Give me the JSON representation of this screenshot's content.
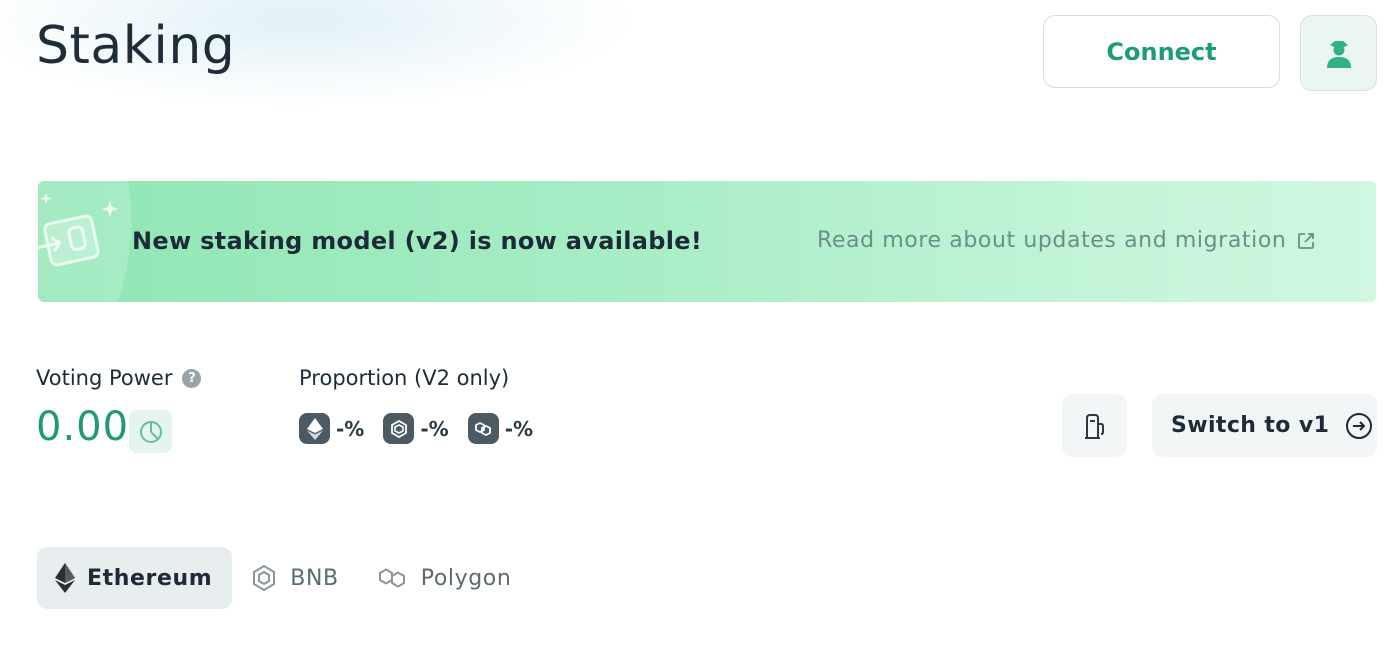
{
  "page": {
    "title": "Staking"
  },
  "header": {
    "connect_label": "Connect"
  },
  "banner": {
    "title": "New staking model (v2) is now available!",
    "link_label": "Read more about updates and migration"
  },
  "voting_power": {
    "label": "Voting Power",
    "value": "0.00",
    "help_glyph": "?"
  },
  "proportion": {
    "label": "Proportion (V2 only)",
    "items": [
      {
        "chain": "ethereum",
        "value": "-%"
      },
      {
        "chain": "bnb",
        "value": "-%"
      },
      {
        "chain": "polygon",
        "value": "-%"
      }
    ]
  },
  "actions": {
    "switch_label": "Switch to v1"
  },
  "tabs": [
    {
      "label": "Ethereum",
      "active": true
    },
    {
      "label": "BNB",
      "active": false
    },
    {
      "label": "Polygon",
      "active": false
    }
  ],
  "colors": {
    "accent": "#1f9a78",
    "banner_start": "#8fe6b4",
    "banner_end": "#d0f7e0"
  }
}
